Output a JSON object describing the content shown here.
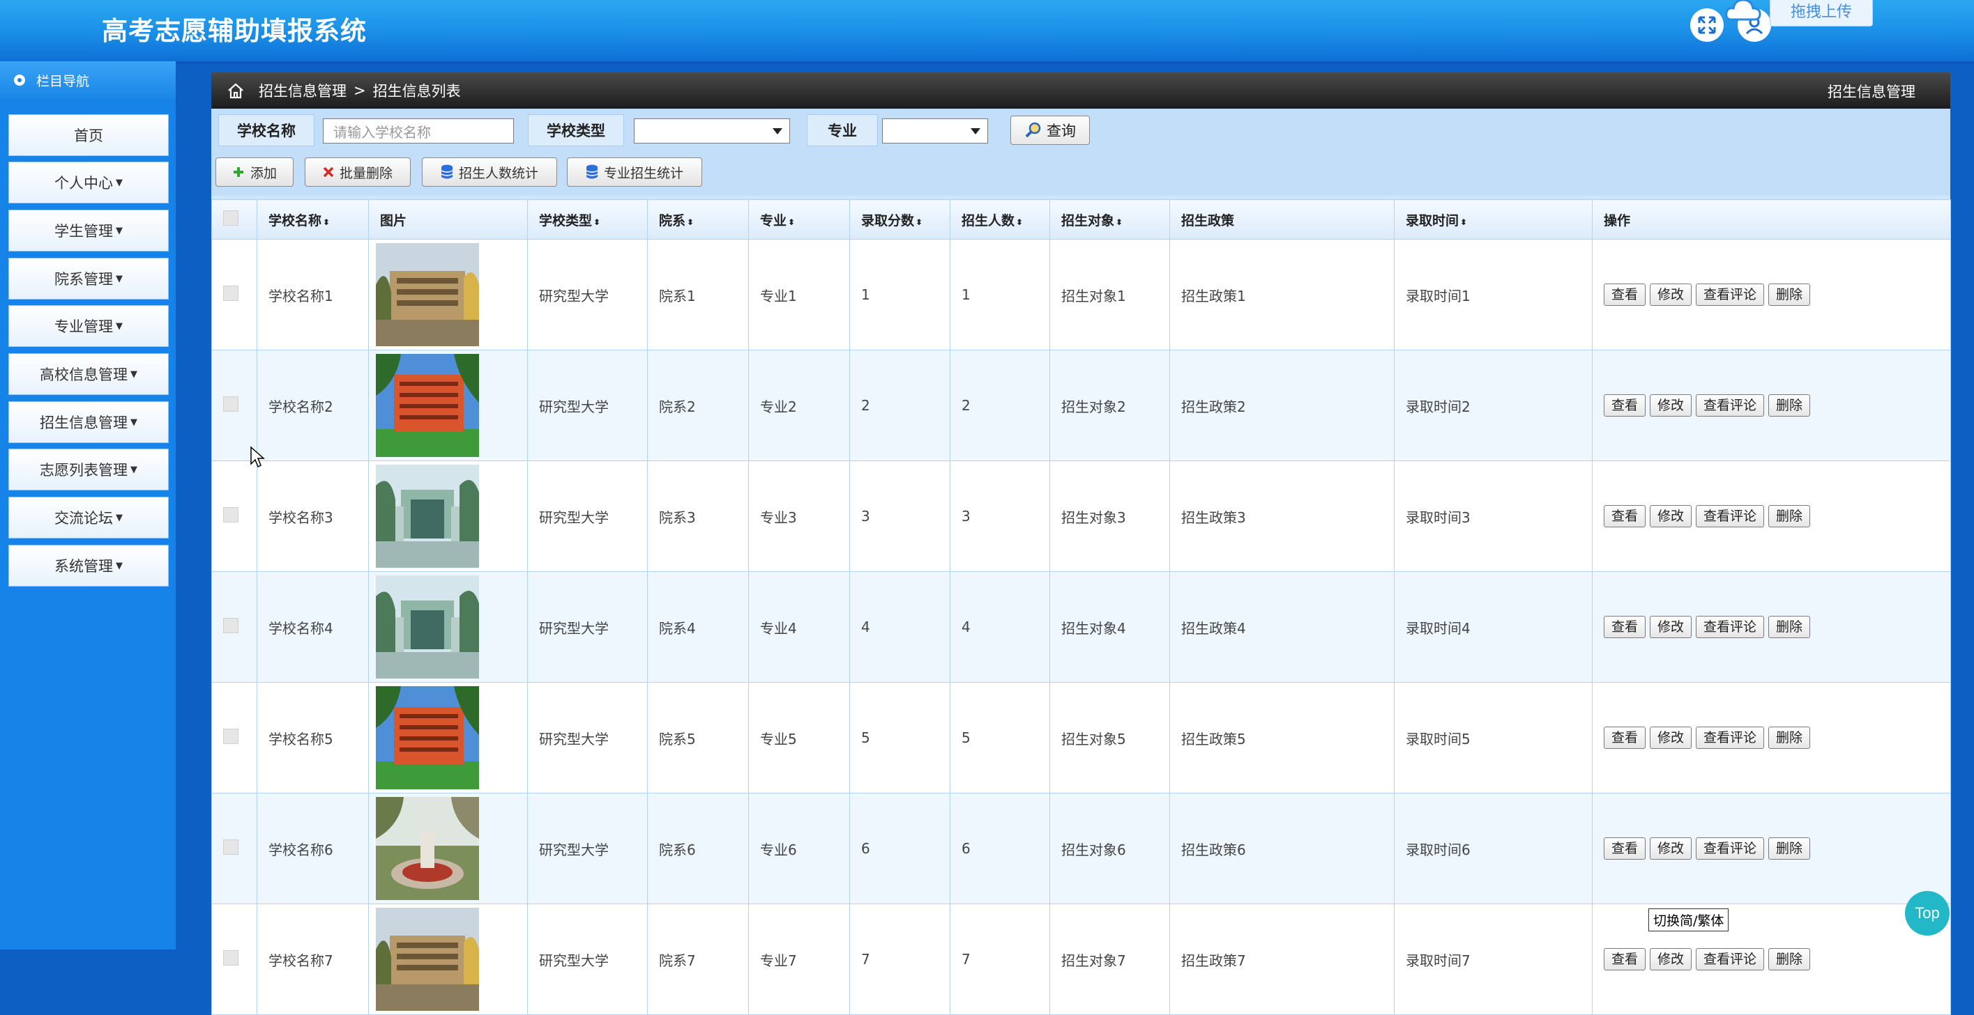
{
  "app": {
    "title": "高考志愿辅助填报系统",
    "upload_label": "拖拽上传"
  },
  "sidebar": {
    "header": "栏目导航",
    "items": [
      {
        "label": "首页"
      },
      {
        "label": "个人中心"
      },
      {
        "label": "学生管理"
      },
      {
        "label": "院系管理"
      },
      {
        "label": "专业管理"
      },
      {
        "label": "高校信息管理"
      },
      {
        "label": "招生信息管理"
      },
      {
        "label": "志愿列表管理"
      },
      {
        "label": "交流论坛"
      },
      {
        "label": "系统管理"
      }
    ]
  },
  "breadcrumb": {
    "root": "招生信息管理",
    "sep": ">",
    "current": "招生信息列表",
    "right_title": "招生信息管理"
  },
  "search": {
    "school_name_label": "学校名称",
    "school_name_placeholder": "请输入学校名称",
    "school_type_label": "学校类型",
    "major_label": "专业",
    "query_label": "查询"
  },
  "toolbar": {
    "add": "添加",
    "batch_delete": "批量删除",
    "enroll_stats": "招生人数统计",
    "major_stats": "专业招生统计"
  },
  "table": {
    "headers": [
      "学校名称",
      "图片",
      "学校类型",
      "院系",
      "专业",
      "录取分数",
      "招生人数",
      "招生对象",
      "招生政策",
      "录取时间",
      "操作"
    ],
    "actions": [
      "查看",
      "修改",
      "查看评论",
      "删除"
    ],
    "rows": [
      {
        "school": "学校名称1",
        "type": "研究型大学",
        "dept": "院系1",
        "major": "专业1",
        "score": "1",
        "count": "1",
        "target": "招生对象1",
        "policy": "招生政策1",
        "time": "录取时间1",
        "img": "building-photo"
      },
      {
        "school": "学校名称2",
        "type": "研究型大学",
        "dept": "院系2",
        "major": "专业2",
        "score": "2",
        "count": "2",
        "target": "招生对象2",
        "policy": "招生政策2",
        "time": "录取时间2",
        "img": "campus-red-building-photo"
      },
      {
        "school": "学校名称3",
        "type": "研究型大学",
        "dept": "院系3",
        "major": "专业3",
        "score": "3",
        "count": "3",
        "target": "招生对象3",
        "policy": "招生政策3",
        "time": "录取时间3",
        "img": "gate-photo"
      },
      {
        "school": "学校名称4",
        "type": "研究型大学",
        "dept": "院系4",
        "major": "专业4",
        "score": "4",
        "count": "4",
        "target": "招生对象4",
        "policy": "招生政策4",
        "time": "录取时间4",
        "img": "gate-photo"
      },
      {
        "school": "学校名称5",
        "type": "研究型大学",
        "dept": "院系5",
        "major": "专业5",
        "score": "5",
        "count": "5",
        "target": "招生对象5",
        "policy": "招生政策5",
        "time": "录取时间5",
        "img": "campus-red-building-photo"
      },
      {
        "school": "学校名称6",
        "type": "研究型大学",
        "dept": "院系6",
        "major": "专业6",
        "score": "6",
        "count": "6",
        "target": "招生对象6",
        "policy": "招生政策6",
        "time": "录取时间6",
        "img": "garden-photo"
      },
      {
        "school": "学校名称7",
        "type": "研究型大学",
        "dept": "院系7",
        "major": "专业7",
        "score": "7",
        "count": "7",
        "target": "招生对象7",
        "policy": "招生政策7",
        "time": "录取时间7",
        "img": "building-photo"
      }
    ]
  },
  "tooltip": "切换简/繁体",
  "top_button": "Top"
}
